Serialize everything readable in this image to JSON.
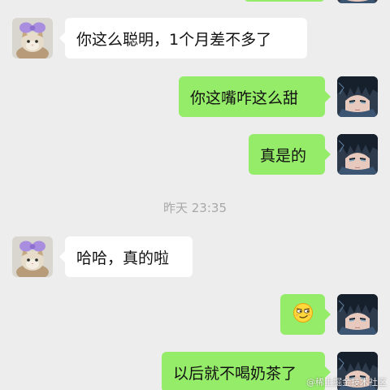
{
  "timestamp": "昨天 23:35",
  "messages": [
    {
      "side": "in",
      "text": "你这么聪明，1个月差不多了"
    },
    {
      "side": "out",
      "text": "你这嘴咋这么甜"
    },
    {
      "side": "out",
      "text": "真是的"
    },
    {
      "side": "in",
      "text": "哈哈，真的啦"
    },
    {
      "side": "out",
      "text": "",
      "icon": "smirk-emoji-icon"
    },
    {
      "side": "out",
      "text": "以后就不喝奶茶了"
    }
  ],
  "watermark": "@稀土掘金技术社区",
  "colors": {
    "background": "#ededed",
    "incoming_bubble": "#ffffff",
    "outgoing_bubble": "#95ec69",
    "timestamp": "#a8a8a8"
  }
}
